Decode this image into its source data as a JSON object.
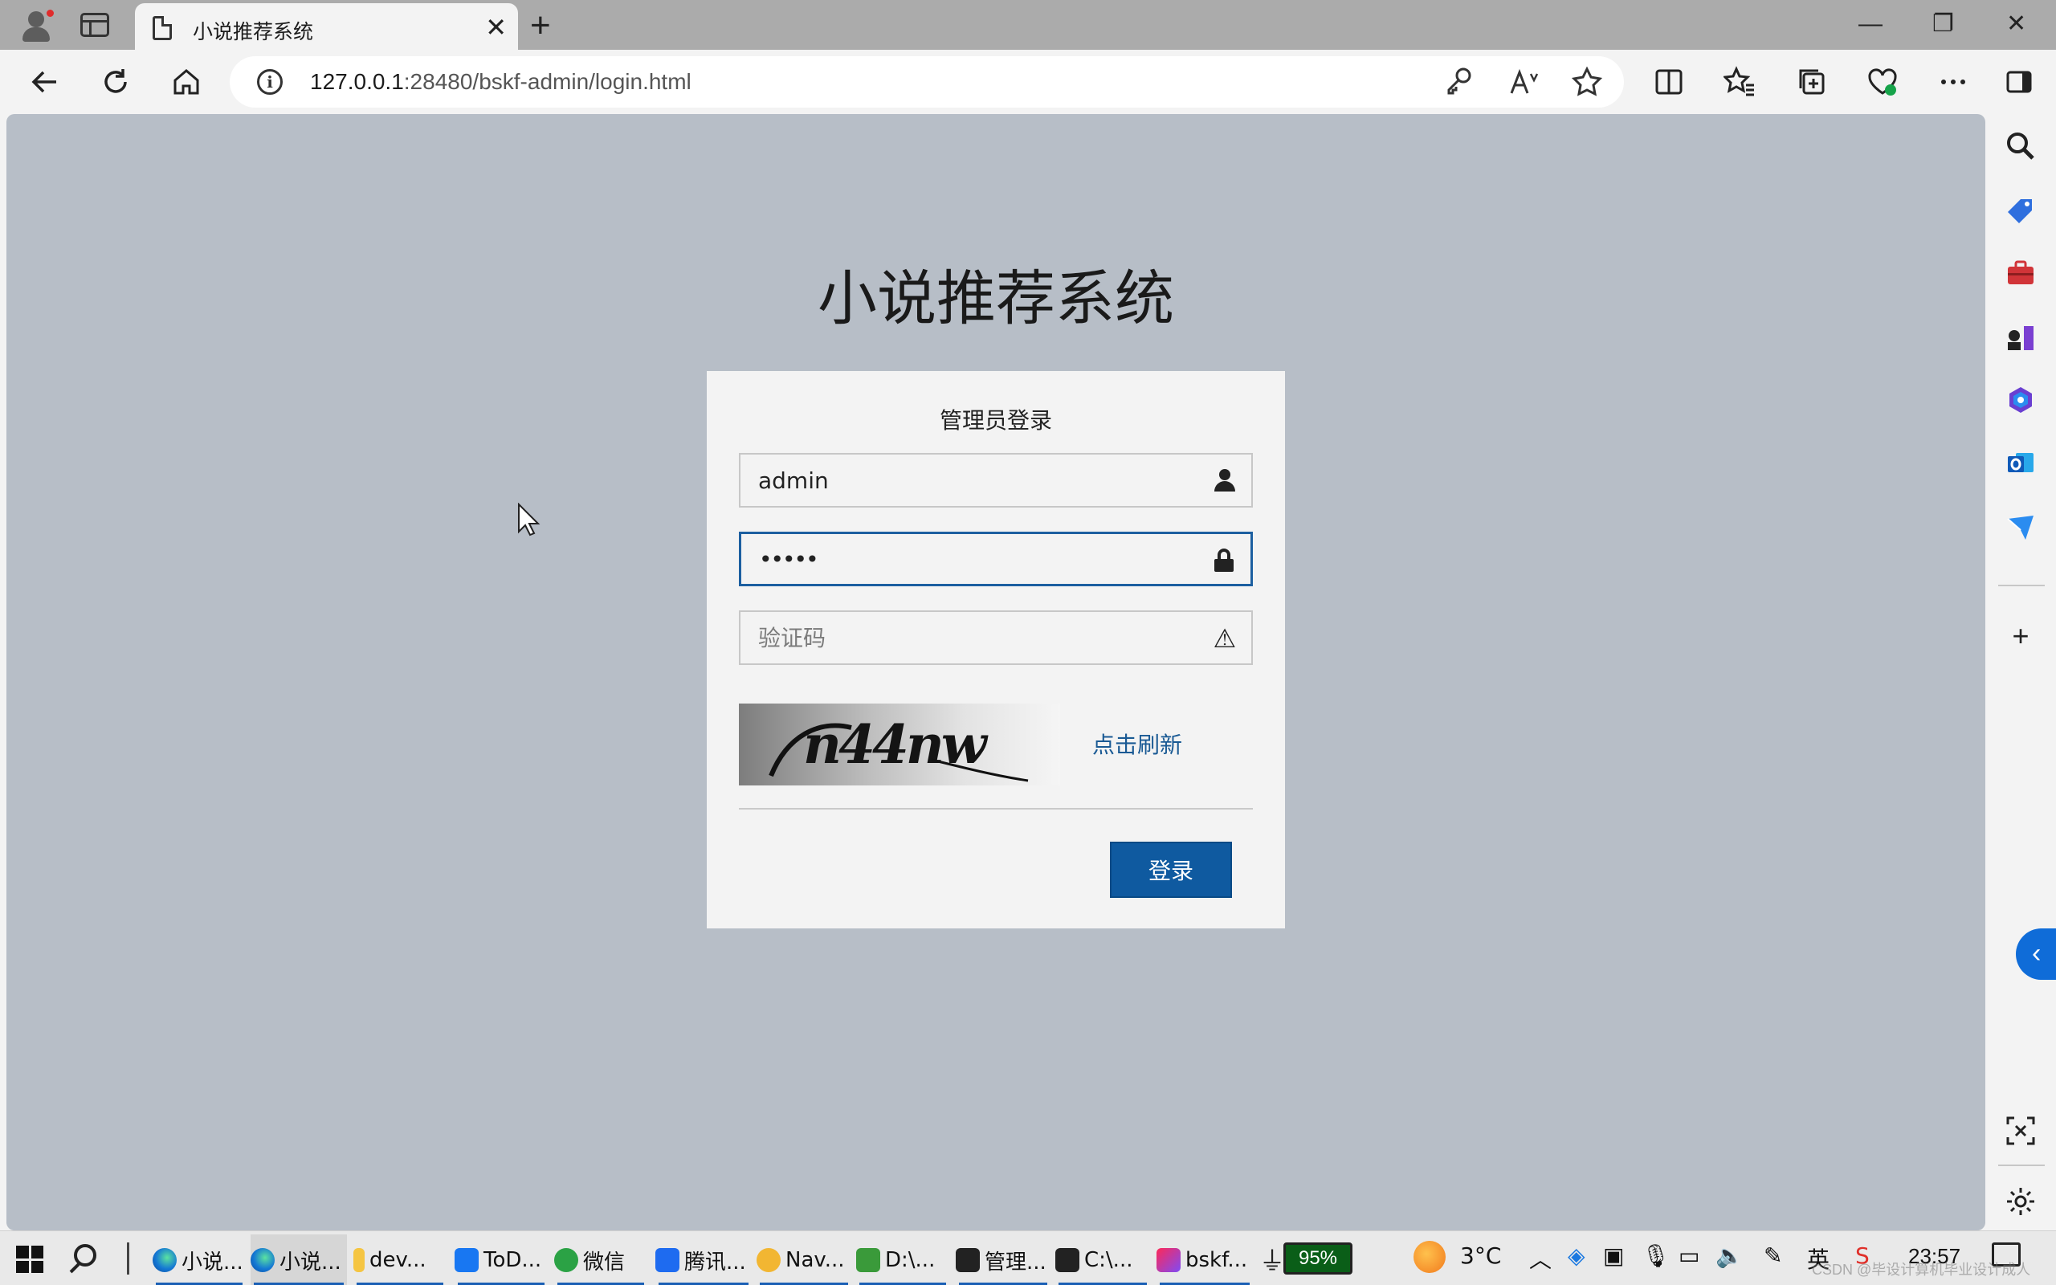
{
  "browser": {
    "tab": {
      "title": "小说推荐系统",
      "close_glyph": "✕"
    },
    "new_tab_glyph": "+",
    "window_controls": {
      "minimize": "—",
      "restore": "❐",
      "close": "✕"
    },
    "address": {
      "host": "127.0.0.1",
      "rest": ":28480/bskf-admin/login.html"
    }
  },
  "page": {
    "app_title": "小说推荐系统",
    "login": {
      "heading": "管理员登录",
      "username": {
        "value": "admin",
        "icon": "user-icon"
      },
      "password": {
        "value": "•••••",
        "icon": "lock-icon"
      },
      "captcha_field": {
        "placeholder": "验证码",
        "value": "",
        "icon": "warning-icon"
      },
      "captcha_image_text": "n44nw",
      "refresh_label": "点击刷新",
      "submit_label": "登录"
    },
    "background_color": "#b7bec7",
    "accent_color": "#0f5aa0"
  },
  "taskbar": {
    "tasks": [
      {
        "label": "小说...",
        "icon": "edge-icon"
      },
      {
        "label": "小说...",
        "icon": "edge-icon"
      },
      {
        "label": "dev...",
        "icon": "folder-icon"
      },
      {
        "label": "ToD...",
        "icon": "todo-icon"
      },
      {
        "label": "微信",
        "icon": "wechat-icon"
      },
      {
        "label": "腾讯...",
        "icon": "tencent-meeting-icon"
      },
      {
        "label": "Nav...",
        "icon": "navicat-icon"
      },
      {
        "label": "D:\\...",
        "icon": "chart-file-icon"
      },
      {
        "label": "管理...",
        "icon": "terminal-icon"
      },
      {
        "label": "C:\\...",
        "icon": "terminal-icon"
      },
      {
        "label": "bskf...",
        "icon": "intellij-icon"
      }
    ],
    "battery": "95%",
    "temperature": "3°C",
    "ime": "英",
    "time": "23:57",
    "watermark": "CSDN @毕设计算机毕业设计成人"
  }
}
